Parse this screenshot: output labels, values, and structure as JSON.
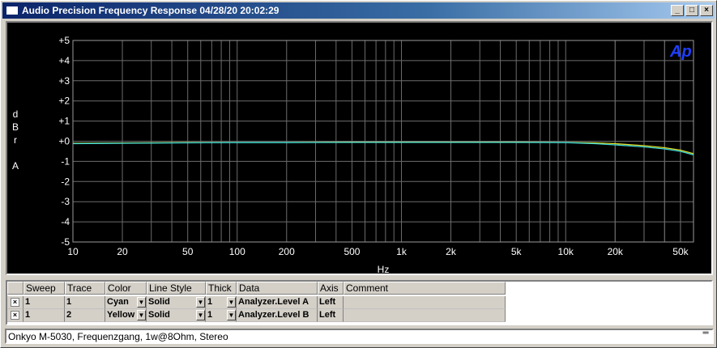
{
  "window": {
    "title": "Audio Precision  Frequency Response  04/28/20 20:02:29",
    "min_glyph": "_",
    "max_glyph": "□",
    "close_glyph": "×"
  },
  "plot": {
    "logo": "Ap",
    "y_axis_label": [
      "d",
      "B",
      "r",
      "",
      "A"
    ],
    "x_axis_label": "Hz",
    "colors": {
      "cyan": "#3ad7dc",
      "yellow": "#dede2a",
      "grid": "#6c6c6c",
      "text": "#ffffff",
      "logo": "#1f3fff"
    }
  },
  "chart_data": {
    "type": "line",
    "title": "Frequency Response",
    "xlabel": "Hz",
    "ylabel": "dBr A",
    "xscale": "log",
    "xlim": [
      10,
      60000
    ],
    "ylim": [
      -5,
      5
    ],
    "x_ticks": [
      10,
      20,
      50,
      100,
      200,
      500,
      1000,
      2000,
      5000,
      10000,
      20000,
      50000
    ],
    "x_tick_labels": [
      "10",
      "20",
      "50",
      "100",
      "200",
      "500",
      "1k",
      "2k",
      "5k",
      "10k",
      "20k",
      "50k"
    ],
    "y_ticks": [
      5,
      4,
      3,
      2,
      1,
      0,
      -1,
      -2,
      -3,
      -4,
      -5
    ],
    "y_tick_labels": [
      "+5",
      "+4",
      "+3",
      "+2",
      "+1",
      "+0",
      "-1",
      "-2",
      "-3",
      "-4",
      "-5"
    ],
    "grid": true,
    "series": [
      {
        "name": "Analyzer.Level A",
        "color": "cyan",
        "x": [
          10,
          20,
          50,
          100,
          200,
          500,
          1000,
          2000,
          5000,
          10000,
          15000,
          20000,
          30000,
          40000,
          50000,
          60000
        ],
        "y": [
          -0.12,
          -0.1,
          -0.08,
          -0.07,
          -0.07,
          -0.06,
          -0.06,
          -0.06,
          -0.06,
          -0.07,
          -0.12,
          -0.18,
          -0.28,
          -0.38,
          -0.5,
          -0.68
        ]
      },
      {
        "name": "Analyzer.Level B",
        "color": "yellow",
        "x": [
          10,
          20,
          50,
          100,
          200,
          500,
          1000,
          2000,
          5000,
          10000,
          15000,
          20000,
          30000,
          40000,
          50000,
          60000
        ],
        "y": [
          -0.1,
          -0.09,
          -0.07,
          -0.06,
          -0.06,
          -0.05,
          -0.05,
          -0.05,
          -0.05,
          -0.06,
          -0.08,
          -0.12,
          -0.22,
          -0.32,
          -0.44,
          -0.62
        ]
      }
    ]
  },
  "legend": {
    "headers": [
      "",
      "Sweep",
      "Trace",
      "Color",
      "Line Style",
      "Thick",
      "Data",
      "Axis",
      "Comment"
    ],
    "rows": [
      {
        "checked": "×",
        "sweep": "1",
        "trace": "1",
        "color": "Cyan",
        "style": "Solid",
        "thick": "1",
        "data": "Analyzer.Level A",
        "axis": "Left",
        "comment": ""
      },
      {
        "checked": "×",
        "sweep": "1",
        "trace": "2",
        "color": "Yellow",
        "style": "Solid",
        "thick": "1",
        "data": "Analyzer.Level B",
        "axis": "Left",
        "comment": ""
      }
    ],
    "dropdown_glyph": "▼"
  },
  "comment": {
    "text": "Onkyo M-5030, Frequenzgang, 1w@8Ohm, Stereo",
    "scroll_glyph": "═"
  }
}
